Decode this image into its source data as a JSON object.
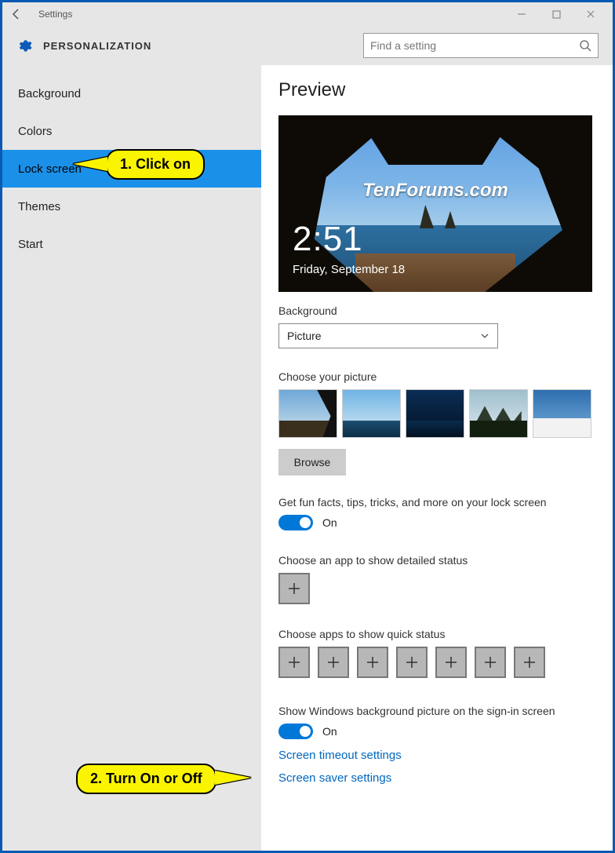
{
  "titlebar": {
    "title": "Settings"
  },
  "header": {
    "heading": "PERSONALIZATION",
    "search_placeholder": "Find a setting"
  },
  "sidebar": {
    "items": [
      {
        "label": "Background"
      },
      {
        "label": "Colors"
      },
      {
        "label": "Lock screen"
      },
      {
        "label": "Themes"
      },
      {
        "label": "Start"
      }
    ]
  },
  "main": {
    "preview_heading": "Preview",
    "watermark": "TenForums.com",
    "clock_time": "2:51",
    "clock_date": "Friday, September 18",
    "background_label": "Background",
    "background_value": "Picture",
    "choose_picture_label": "Choose your picture",
    "browse_label": "Browse",
    "funfacts_label": "Get fun facts, tips, tricks, and more on your lock screen",
    "funfacts_state": "On",
    "detailed_status_label": "Choose an app to show detailed status",
    "quick_status_label": "Choose apps to show quick status",
    "signin_bg_label": "Show Windows background picture on the sign-in screen",
    "signin_bg_state": "On",
    "link_timeout": "Screen timeout settings",
    "link_screensaver": "Screen saver settings"
  },
  "callouts": {
    "c1": "1. Click on",
    "c2": "2. Turn On or Off"
  }
}
